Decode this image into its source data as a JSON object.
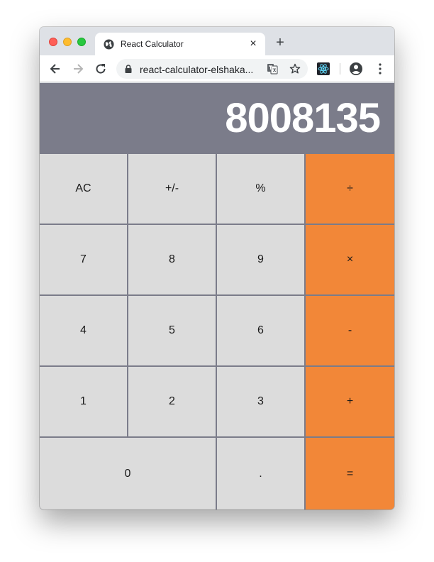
{
  "browser": {
    "tab_title": "React Calculator",
    "tab_close": "×",
    "new_tab": "+",
    "url": "react-calculator-elshaka..."
  },
  "calculator": {
    "display": "8008135",
    "keys": {
      "ac": "AC",
      "plus_minus": "+/-",
      "percent": "%",
      "divide": "÷",
      "seven": "7",
      "eight": "8",
      "nine": "9",
      "multiply": "×",
      "four": "4",
      "five": "5",
      "six": "6",
      "subtract": "-",
      "one": "1",
      "two": "2",
      "three": "3",
      "add": "+",
      "zero": "0",
      "decimal": ".",
      "equals": "="
    }
  },
  "colors": {
    "display_bg": "#7b7c8a",
    "key_bg": "#dcdcdc",
    "operator_bg": "#f28738"
  }
}
